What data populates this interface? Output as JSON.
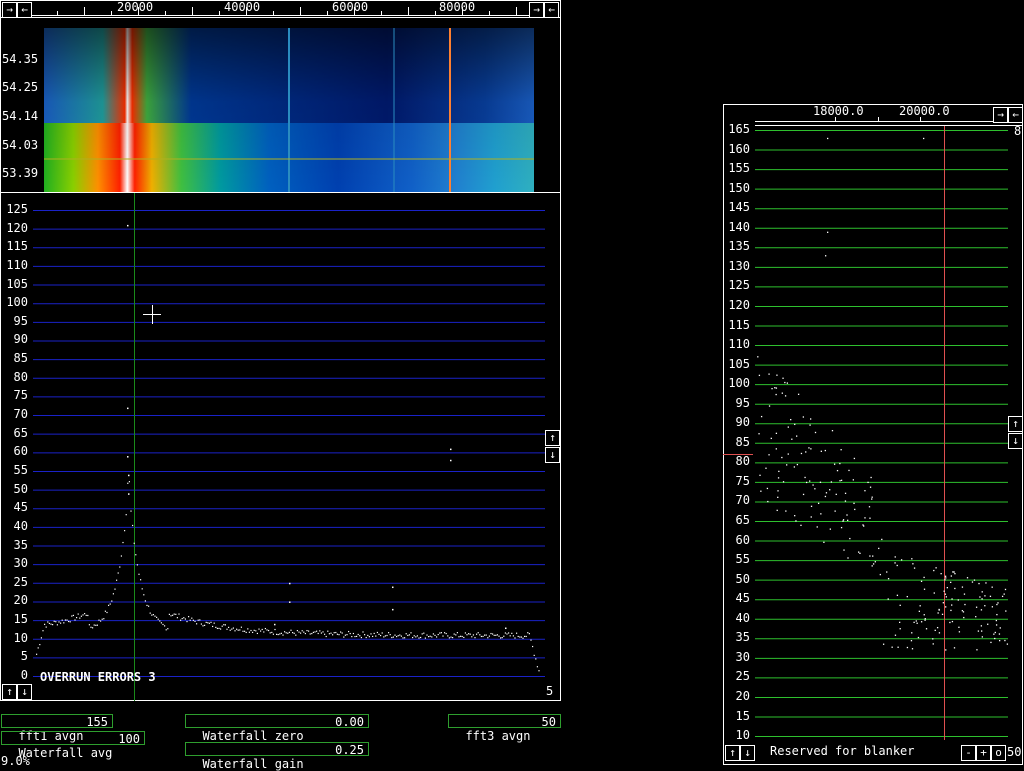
{
  "main_window": {
    "freq_axis": {
      "labels": [
        "20000",
        "40000",
        "60000",
        "80000"
      ]
    },
    "waterfall": {
      "time_labels": [
        "54.35",
        "54.25",
        "54.14",
        "54.03",
        "53.39"
      ]
    },
    "spectrum": {
      "y_labels": [
        "125",
        "120",
        "115",
        "110",
        "105",
        "100",
        "95",
        "90",
        "85",
        "80",
        "75",
        "70",
        "65",
        "60",
        "55",
        "50",
        "45",
        "40",
        "35",
        "30",
        "25",
        "20",
        "15",
        "10",
        "5",
        "0"
      ],
      "status_text": "OVERRUN ERRORS 3",
      "corner_value": "5"
    },
    "buttons": {
      "left_arrow": "→",
      "right_arrow": "→",
      "back_arrow": "←",
      "up_arrow": "↑",
      "down_arrow": "↓"
    }
  },
  "params": {
    "fft1_avgn": {
      "label": "fft1 avgn",
      "value": "155"
    },
    "waterfall_avg": {
      "label": "Waterfall avg",
      "value": "100"
    },
    "waterfall_zero": {
      "label": "Waterfall zero",
      "value": "0.00"
    },
    "waterfall_gain": {
      "label": "Waterfall gain",
      "value": "0.25"
    },
    "fft3_avgn": {
      "label": "fft3 avgn",
      "value": "50"
    }
  },
  "status": {
    "cpu_load": "9.0%"
  },
  "blanker_window": {
    "freq_labels": [
      "18000.0",
      "20000.0"
    ],
    "top_right_value": "8",
    "y_labels": [
      "165",
      "160",
      "155",
      "150",
      "145",
      "140",
      "135",
      "130",
      "125",
      "120",
      "115",
      "110",
      "105",
      "100",
      "95",
      "90",
      "85",
      "80",
      "75",
      "70",
      "65",
      "60",
      "55",
      "50",
      "45",
      "40",
      "35",
      "30",
      "25",
      "20",
      "15",
      "10"
    ],
    "reserved_text": "Reserved for blanker",
    "minus_label": "-",
    "plus_label": "+",
    "o_label": "o",
    "bottom_value": "50"
  },
  "colors": {
    "grid_blue": "#1a22c8",
    "grid_green": "#2ec02e",
    "frame_green": "#2e9e2e",
    "marker_red": "#e05050"
  }
}
